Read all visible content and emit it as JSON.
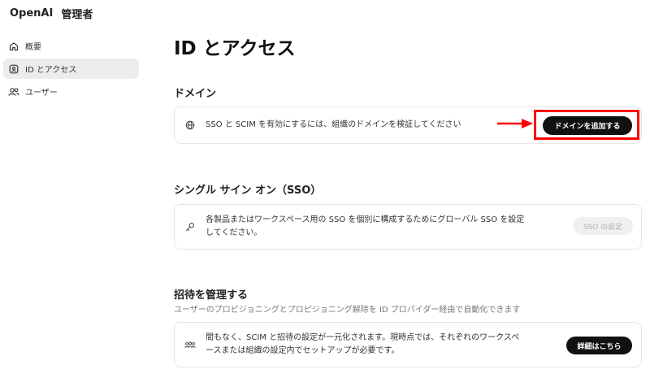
{
  "header": {
    "brand": "OpenAI",
    "admin": "管理者"
  },
  "sidebar": {
    "items": [
      {
        "label": "概要",
        "icon": "home-icon",
        "active": false
      },
      {
        "label": "ID とアクセス",
        "icon": "shield-user-icon",
        "active": true
      },
      {
        "label": "ユーザー",
        "icon": "users-icon",
        "active": false
      }
    ]
  },
  "main": {
    "title": "ID とアクセス",
    "domain": {
      "heading": "ドメイン",
      "text": "SSO と SCIM を有効にするには、組織のドメインを検証してください",
      "button": "ドメインを追加する",
      "icon": "globe-icon"
    },
    "sso": {
      "heading": "シングル サイン オン（SSO）",
      "text_line1": "各製品またはワークスペース用の SSO を個別に構成するためにグローバル SSO を設定",
      "text_line2": "してください。",
      "button": "SSO の設定",
      "icon": "key-icon"
    },
    "invites": {
      "heading": "招待を管理する",
      "subtitle": "ユーザーのプロビジョニングとプロビジョニング解除を ID プロバイダー経由で自動化できます",
      "text_line1": "間もなく、SCIM と招待の設定が一元化されます。現時点では、それぞれのワークスペ",
      "text_line2": "ースまたは組織の設定内でセットアップが必要です。",
      "button": "詳細はこちら",
      "icon": "group-icon"
    }
  },
  "annotation": {
    "color": "#ff0000"
  }
}
